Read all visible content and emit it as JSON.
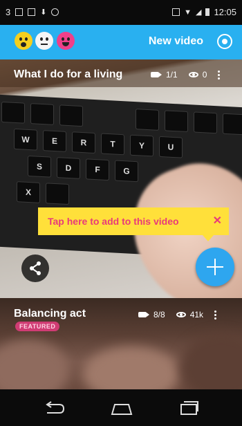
{
  "status_bar": {
    "left_indicator": "3",
    "time": "12:05"
  },
  "app_bar": {
    "title": "New video",
    "emoji_colors": [
      "#f5cf1f",
      "#f5f5f5",
      "#ef3f8a"
    ]
  },
  "video_card_1": {
    "title": "What I do for a living",
    "clips_count": "1/1",
    "views": "0",
    "keys": [
      "W",
      "E",
      "R",
      "T",
      "Y",
      "U",
      "S",
      "D",
      "F",
      "G",
      "X"
    ]
  },
  "tooltip": {
    "text": "Tap here to add to this video",
    "close_glyph": "✕"
  },
  "video_card_2": {
    "title": "Balancing act",
    "badge": "FEATURED",
    "clips_count": "8/8",
    "views": "41k"
  },
  "colors": {
    "accent": "#29b0f0",
    "fab": "#2ea6ef",
    "tooltip_bg": "#ffe03a",
    "tooltip_text": "#e83a7a",
    "badge": "#d03c74"
  },
  "icons": {
    "settings": "settings-icon",
    "share": "share-icon",
    "add": "add-icon",
    "back": "back-icon",
    "home": "home-icon",
    "recents": "recents-icon"
  }
}
